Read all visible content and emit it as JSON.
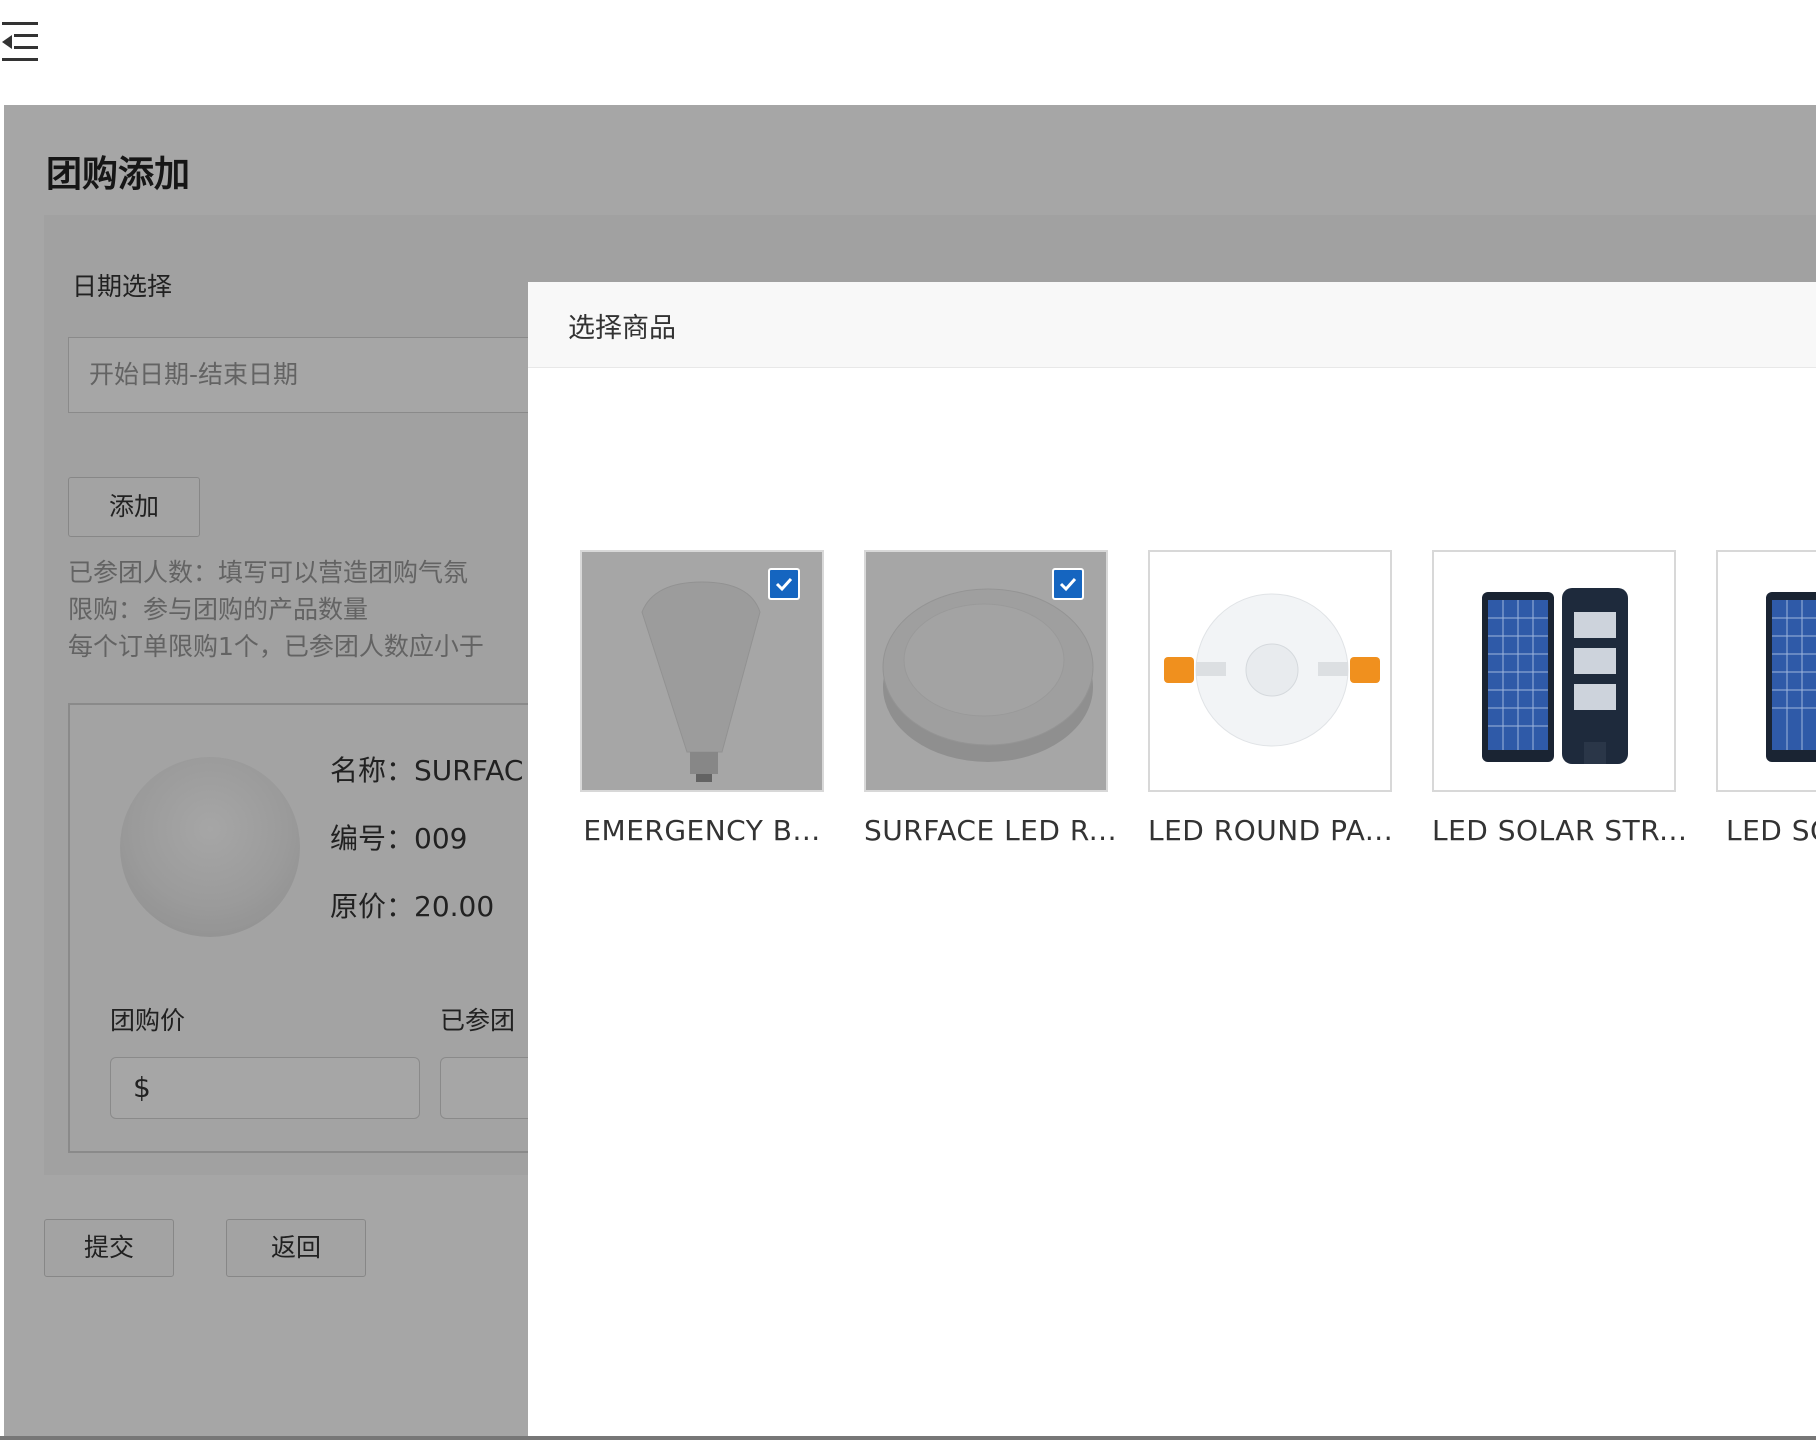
{
  "header": {
    "menu_icon": "menu-collapse-icon"
  },
  "page": {
    "title": "团购添加",
    "date_label": "日期选择",
    "date_placeholder": "开始日期-结束日期",
    "add_button": "添加",
    "hints": [
      "已参团人数：填写可以营造团购气氛",
      "限购：参与团购的产品数量",
      "每个订单限购1个，已参团人数应小于"
    ],
    "product": {
      "name": "名称：SURFAC",
      "code": "编号：009",
      "price": "原价：20.00",
      "group_price_label": "团购价",
      "joined_label": "已参团",
      "currency_prefix": "$"
    },
    "submit_button": "提交",
    "back_button": "返回"
  },
  "modal": {
    "title": "选择商品",
    "items": [
      {
        "name": "EMERGENCY B...",
        "selected": true,
        "image": "bulb"
      },
      {
        "name": "SURFACE LED R...",
        "selected": true,
        "image": "round-disc"
      },
      {
        "name": "LED ROUND PA...",
        "selected": false,
        "image": "round-panel"
      },
      {
        "name": "LED SOLAR STR...",
        "selected": false,
        "image": "solar-street-light"
      },
      {
        "name": "LED SO",
        "selected": false,
        "image": "solar-street-light"
      }
    ]
  },
  "colors": {
    "checkbox": "#1565c0",
    "overlay": "rgba(0,0,0,0.35)",
    "accent_orange": "#f0901e"
  }
}
